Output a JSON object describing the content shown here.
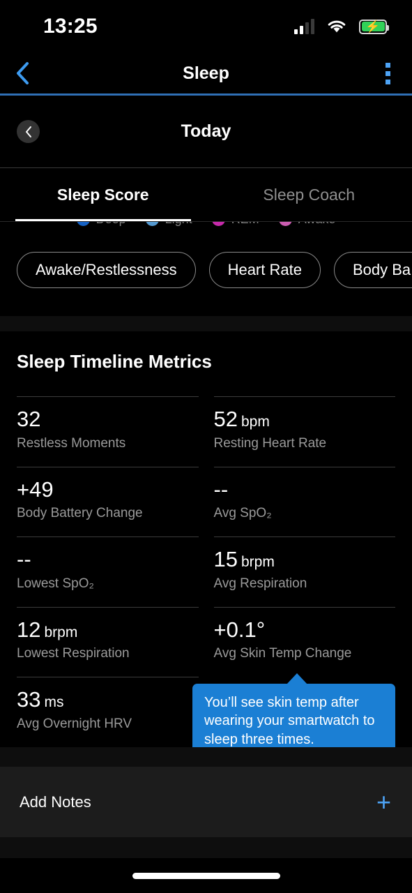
{
  "status_bar": {
    "time": "13:25",
    "signal_icon": "cellular-signal-icon",
    "wifi_icon": "wifi-icon",
    "battery_icon": "battery-charging-icon",
    "battery_color": "#31d158"
  },
  "top_nav": {
    "back_icon": "chevron-left-icon",
    "title": "Sleep",
    "menu_icon": "overflow-menu-icon",
    "accent_color": "#4da3f5",
    "underline_color": "#2f6fb5"
  },
  "date_bar": {
    "prev_icon": "chevron-left-icon",
    "label": "Today"
  },
  "tabs": [
    {
      "label": "Sleep Score",
      "active": true
    },
    {
      "label": "Sleep Coach",
      "active": false
    }
  ],
  "chart_legend": [
    {
      "label": "Deep",
      "color": "#1a73e8"
    },
    {
      "label": "Light",
      "color": "#64b5f6"
    },
    {
      "label": "REM",
      "color": "#e832c8"
    },
    {
      "label": "Awake",
      "color": "#ef6ed0"
    }
  ],
  "chips": [
    {
      "label": "Awake/Restlessness"
    },
    {
      "label": "Heart Rate"
    },
    {
      "label": "Body Ba"
    }
  ],
  "metrics_section": {
    "title": "Sleep Timeline Metrics",
    "metrics": [
      {
        "value": "32",
        "unit": "",
        "label": "Restless Moments"
      },
      {
        "value": "52",
        "unit": "bpm",
        "label": "Resting Heart Rate"
      },
      {
        "value": "+49",
        "unit": "",
        "label": "Body Battery Change"
      },
      {
        "value": "--",
        "unit": "",
        "label": "Avg SpO₂"
      },
      {
        "value": "--",
        "unit": "",
        "label": "Lowest SpO₂"
      },
      {
        "value": "15",
        "unit": "brpm",
        "label": "Avg Respiration"
      },
      {
        "value": "12",
        "unit": "brpm",
        "label": "Lowest Respiration"
      },
      {
        "value": "+0.1°",
        "unit": "",
        "label": "Avg Skin Temp Change"
      },
      {
        "value": "33",
        "unit": "ms",
        "label": "Avg Overnight HRV"
      }
    ]
  },
  "tooltip": {
    "text": "You’ll see skin temp after wearing your smartwatch to sleep three times.",
    "background_color": "#1b7fd4"
  },
  "notes_bar": {
    "label": "Add Notes",
    "add_icon": "plus-icon",
    "add_icon_color": "#4da3f5"
  },
  "home_indicator": {
    "visible": true
  }
}
